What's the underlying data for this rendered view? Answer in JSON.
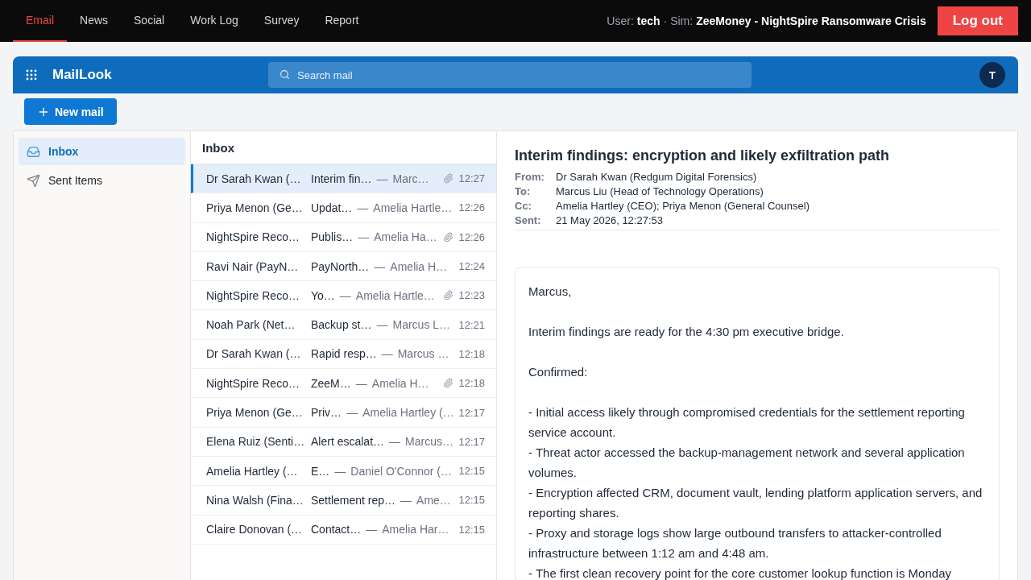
{
  "nav": {
    "tabs": [
      {
        "label": "Email",
        "selected": true
      },
      {
        "label": "News",
        "selected": false
      },
      {
        "label": "Social",
        "selected": false
      },
      {
        "label": "Work Log",
        "selected": false
      },
      {
        "label": "Survey",
        "selected": false
      },
      {
        "label": "Report",
        "selected": false
      }
    ],
    "user_label": "User:",
    "user": "tech",
    "sim_label": "· Sim:",
    "sim": "ZeeMoney - NightSpire Ransomware Crisis",
    "logout": "Log out"
  },
  "app": {
    "title": "MailLook",
    "search": {
      "placeholder": "Search mail"
    },
    "avatar": "T"
  },
  "new_mail": "New mail",
  "folders": [
    {
      "label": "Inbox",
      "selected": true
    },
    {
      "label": "Sent Items",
      "selected": false
    }
  ],
  "list": {
    "title": "Inbox",
    "separator": "—",
    "messages": [
      {
        "sender": "Dr Sarah Kwan (…",
        "subject": "Interim fin…",
        "preview": "Marc…",
        "attachment": true,
        "time": "12:27",
        "selected": true
      },
      {
        "sender": "Priya Menon (Ge…",
        "subject": "Updat…",
        "preview": "Amelia Hartle…",
        "attachment": false,
        "time": "12:26",
        "selected": false
      },
      {
        "sender": "NightSpire Reco…",
        "subject": "Publis…",
        "preview": "Amelia Ha…",
        "attachment": true,
        "time": "12:26",
        "selected": false
      },
      {
        "sender": "Ravi Nair (PayN…",
        "subject": "PayNorth…",
        "preview": "Amelia H…",
        "attachment": false,
        "time": "12:24",
        "selected": false
      },
      {
        "sender": "NightSpire Reco…",
        "subject": "Yo…",
        "preview": "Amelia Hartle…",
        "attachment": true,
        "time": "12:23",
        "selected": false
      },
      {
        "sender": "Noah Park (Net…",
        "subject": "Backup st…",
        "preview": "Marcus L…",
        "attachment": false,
        "time": "12:21",
        "selected": false
      },
      {
        "sender": "Dr Sarah Kwan (…",
        "subject": "Rapid resp…",
        "preview": "Marcus …",
        "attachment": false,
        "time": "12:18",
        "selected": false
      },
      {
        "sender": "NightSpire Reco…",
        "subject": "ZeeM…",
        "preview": "Amelia H…",
        "attachment": true,
        "time": "12:18",
        "selected": false
      },
      {
        "sender": "Priya Menon (Ge…",
        "subject": "Priv…",
        "preview": "Amelia Hartley (…",
        "attachment": false,
        "time": "12:17",
        "selected": false
      },
      {
        "sender": "Elena Ruiz (Senti…",
        "subject": "Alert escalat…",
        "preview": "Marcus…",
        "attachment": false,
        "time": "12:17",
        "selected": false
      },
      {
        "sender": "Amelia Hartley (…",
        "subject": "E…",
        "preview": "Daniel O'Connor (…",
        "attachment": false,
        "time": "12:15",
        "selected": false
      },
      {
        "sender": "Nina Walsh (Fina…",
        "subject": "Settlement rep…",
        "preview": "Ame…",
        "attachment": false,
        "time": "12:15",
        "selected": false
      },
      {
        "sender": "Claire Donovan (…",
        "subject": "Contact…",
        "preview": "Amelia Har…",
        "attachment": false,
        "time": "12:15",
        "selected": false
      }
    ]
  },
  "message": {
    "subject": "Interim findings: encryption and likely exfiltration path",
    "headers": [
      {
        "label": "From:",
        "value": "Dr Sarah Kwan (Redgum Digital Forensics)"
      },
      {
        "label": "To:",
        "value": "Marcus Liu (Head of Technology Operations)"
      },
      {
        "label": "Cc:",
        "value": "Amelia Hartley (CEO); Priya Menon (General Counsel)"
      },
      {
        "label": "Sent:",
        "value": "21 May 2026, 12:27:53"
      }
    ],
    "body": [
      {
        "kind": "para",
        "text": "Marcus,"
      },
      {
        "kind": "para",
        "text": "Interim findings are ready for the 4:30 pm executive bridge."
      },
      {
        "kind": "para",
        "text": "Confirmed:"
      },
      {
        "kind": "line",
        "text": "- Initial access likely through compromised credentials for the settlement reporting service account."
      },
      {
        "kind": "line",
        "text": "- Threat actor accessed the backup-management network and several application volumes."
      },
      {
        "kind": "line",
        "text": "- Encryption affected CRM, document vault, lending platform application servers, and reporting shares."
      },
      {
        "kind": "line",
        "text": "- Proxy and storage logs show large outbound transfers to attacker-controlled infrastructure between 1:12 am and 4:48 am."
      },
      {
        "kind": "line",
        "text": "- The first clean recovery point for the core customer lookup function is Monday"
      }
    ]
  }
}
